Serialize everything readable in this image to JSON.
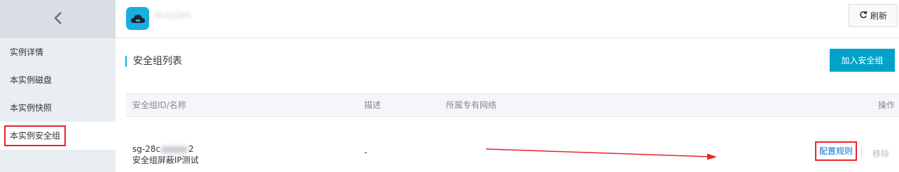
{
  "sidebar": {
    "items": [
      {
        "label": "实例详情"
      },
      {
        "label": "本实例磁盘"
      },
      {
        "label": "本实例快照"
      },
      {
        "label": "本实例安全组"
      }
    ]
  },
  "header": {
    "instance_name": "mejian",
    "refresh_label": "刷新"
  },
  "section": {
    "title": "安全组列表",
    "add_button_label": "加入安全组"
  },
  "table": {
    "columns": [
      "安全组ID/名称",
      "描述",
      "所属专有网络",
      "操作"
    ],
    "rows": [
      {
        "id_prefix": "sg-28c",
        "id_suffix": "2",
        "name": "安全组屏蔽IP测试",
        "description": "-",
        "vpc": "",
        "actions": [
          "配置规则",
          "移除"
        ]
      }
    ]
  },
  "colors": {
    "accent": "#00a2ca",
    "logo": "#19aee0",
    "link": "#0070cc",
    "highlight": "#e8232b"
  }
}
